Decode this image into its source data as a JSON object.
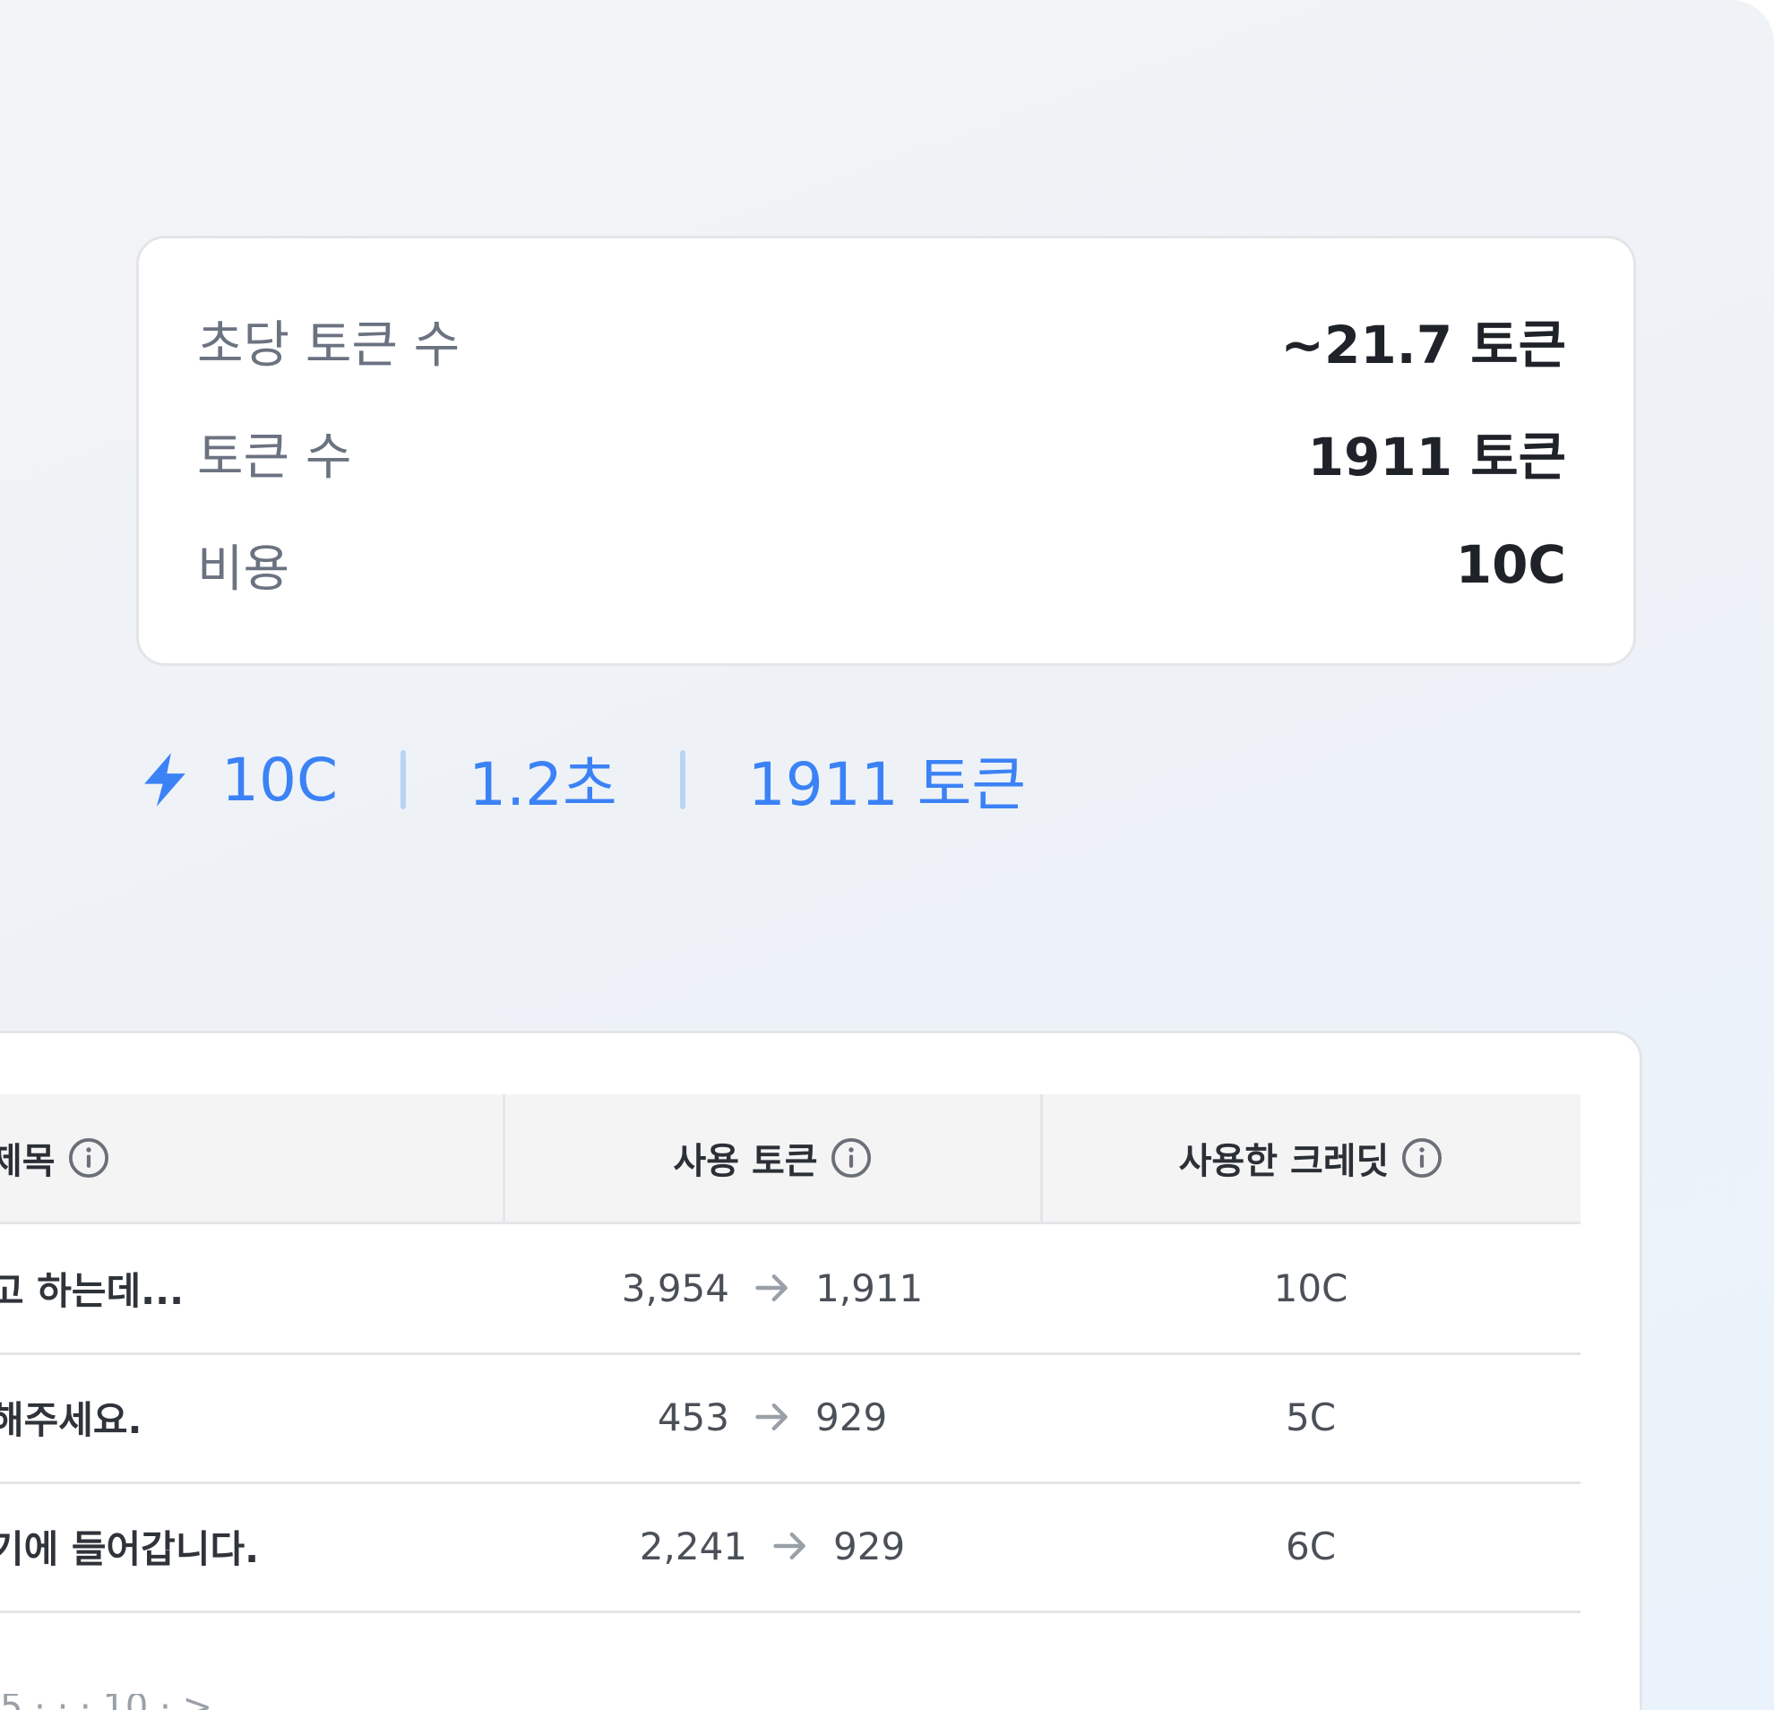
{
  "stats": {
    "tokens_per_second": {
      "label": "초당 토큰 수",
      "value": "~21.7 토큰"
    },
    "token_count": {
      "label": "토큰 수",
      "value": "1911 토큰"
    },
    "cost": {
      "label": "비용",
      "value": "10C"
    }
  },
  "summary": {
    "icon": "bolt-icon",
    "credits": "10C",
    "duration": "1.2초",
    "tokens": "1911 토큰",
    "accent_color": "#3b82f6"
  },
  "table": {
    "headers": [
      "제목",
      "사용 토큰",
      "사용한 크레딧"
    ],
    "rows": [
      {
        "title": "고 하는데...",
        "tokens_in": "3,954",
        "tokens_out": "1,911",
        "credits": "10C"
      },
      {
        "title": "해주세요.",
        "tokens_in": "453",
        "tokens_out": "929",
        "credits": "5C"
      },
      {
        "title": "기에 들어갑니다.",
        "tokens_in": "2,241",
        "tokens_out": "929",
        "credits": "6C"
      }
    ],
    "footer_partial": "5 · · · 10 · >"
  }
}
